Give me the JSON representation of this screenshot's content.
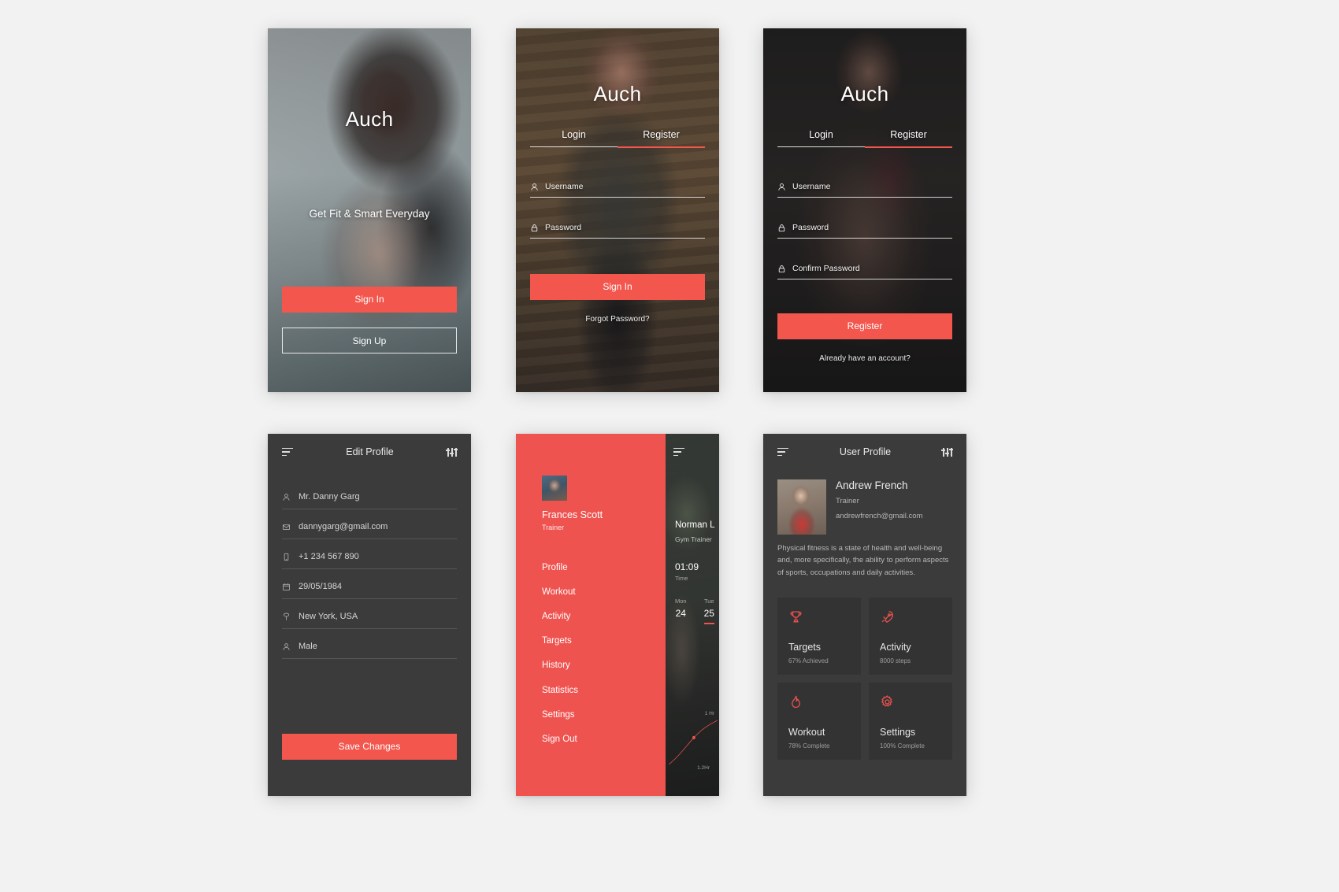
{
  "brand": "Auch",
  "screen_splash": {
    "tagline": "Get Fit & Smart Everyday",
    "sign_in": "Sign In",
    "sign_up": "Sign Up"
  },
  "screen_login": {
    "tab_login": "Login",
    "tab_register": "Register",
    "username_placeholder": "Username",
    "password_placeholder": "Password",
    "sign_in": "Sign In",
    "forgot": "Forgot Password?"
  },
  "screen_register": {
    "tab_login": "Login",
    "tab_register": "Register",
    "username_placeholder": "Username",
    "password_placeholder": "Password",
    "confirm_placeholder": "Confirm Password",
    "register": "Register",
    "already": "Already have an account?"
  },
  "screen_edit_profile": {
    "title": "Edit Profile",
    "fields": [
      {
        "icon": "user-icon",
        "value": "Mr. Danny Garg"
      },
      {
        "icon": "mail-icon",
        "value": "dannygarg@gmail.com"
      },
      {
        "icon": "phone-icon",
        "value": "+1 234 567 890"
      },
      {
        "icon": "calendar-icon",
        "value": "29/05/1984"
      },
      {
        "icon": "location-icon",
        "value": "New York, USA"
      },
      {
        "icon": "gender-icon",
        "value": "Male"
      }
    ],
    "save": "Save Changes"
  },
  "screen_drawer": {
    "user_name": "Frances Scott",
    "user_role": "Trainer",
    "menu": [
      "Profile",
      "Workout",
      "Activity",
      "Targets",
      "History",
      "Statistics",
      "Settings",
      "Sign Out"
    ],
    "behind": {
      "name": "Norman L",
      "role": "Gym Trainer",
      "time_value": "01:09",
      "time_label": "Time",
      "days": [
        {
          "label": "Mon",
          "num": "24",
          "selected": false
        },
        {
          "label": "Tue",
          "num": "25",
          "selected": true
        }
      ],
      "chart_hi": "1 Hr",
      "chart_lo": "1.2Hr"
    }
  },
  "screen_user_profile": {
    "title": "User Profile",
    "name": "Andrew French",
    "role": "Trainer",
    "email": "andrewfrench@gmail.com",
    "bio": "Physical fitness is a state of health and well-being and, more specifically, the ability to perform aspects of sports, occupations and daily activities.",
    "cards": [
      {
        "icon": "trophy-icon",
        "label": "Targets",
        "sub": "67% Achieved"
      },
      {
        "icon": "rocket-icon",
        "label": "Activity",
        "sub": "8000 steps"
      },
      {
        "icon": "flame-icon",
        "label": "Workout",
        "sub": "78% Complete"
      },
      {
        "icon": "gear-icon",
        "label": "Settings",
        "sub": "100% Complete"
      }
    ]
  },
  "colors": {
    "accent": "#ef5350",
    "accent_button": "#f2564d",
    "panel": "#3b3b3b",
    "card": "#333333"
  }
}
